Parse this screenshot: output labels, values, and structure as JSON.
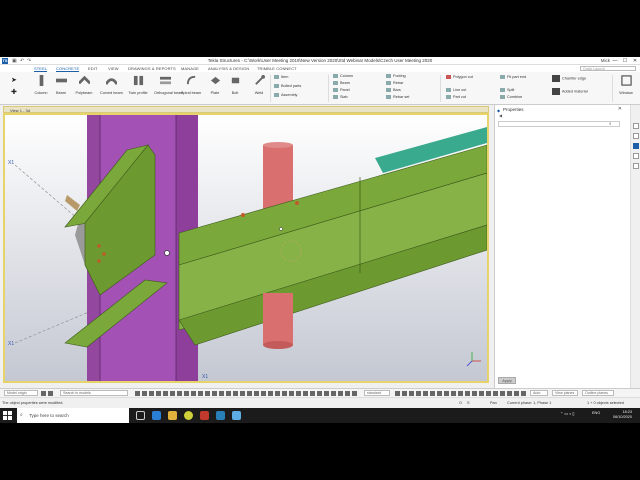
{
  "window": {
    "title": "Tekla Structures - C:\\Work\\User Meeting 2019\\New Version 2020\\Xtd Webinar Models\\Czech User Meeting 2020",
    "user": "Mick",
    "logo": "TS",
    "controls": [
      "—",
      "☐",
      "✕"
    ]
  },
  "ribbon_tabs": [
    {
      "label": "STEEL",
      "active": true
    },
    {
      "label": "CONCRETE",
      "active": true
    },
    {
      "label": "EDIT"
    },
    {
      "label": "VIEW"
    },
    {
      "label": "DRAWINGS & REPORTS"
    },
    {
      "label": "MANAGE"
    },
    {
      "label": "ANALYSIS & DESIGN"
    },
    {
      "label": "TRIMBLE CONNECT"
    }
  ],
  "quick_launch": {
    "placeholder": "Quick Launch"
  },
  "ribbon": {
    "tools": [
      {
        "label": "Column",
        "icon": "column-icon"
      },
      {
        "label": "Beam",
        "icon": "beam-icon"
      },
      {
        "label": "Polybeam",
        "icon": "polybeam-icon"
      },
      {
        "label": "Curved beam",
        "icon": "curved-beam-icon"
      },
      {
        "label": "Twin profile",
        "icon": "twin-profile-icon"
      },
      {
        "label": "Orthogonal beam",
        "icon": "orthogonal-beam-icon"
      },
      {
        "label": "Spiral beam",
        "icon": "spiral-beam-icon"
      },
      {
        "label": "Plate",
        "icon": "plate-icon"
      },
      {
        "label": "Bolt",
        "icon": "bolt-icon"
      },
      {
        "label": "Weld",
        "icon": "weld-icon"
      }
    ],
    "small_tools": {
      "item": "Item",
      "bolted_parts": "Bolted parts",
      "assembly": "Assembly",
      "column": "Column",
      "beam": "Beam",
      "panel": "Panel",
      "slab": "Slab",
      "footing": "Footing",
      "rebar": "Rebar",
      "bars": "Bars",
      "rebar_set": "Rebar set",
      "polygon_cut": "Polygon cut",
      "line_cut": "Line cut",
      "part_cut": "Part cut",
      "fit_part_end": "Fit part end",
      "split": "Split",
      "combine": "Combine",
      "chamfer_edge": "Chamfer edge",
      "added_material": "Added material",
      "window": "Window"
    }
  },
  "view": {
    "title": "View 1 - 3d",
    "axis_labels": {
      "left_top": "X1",
      "left_bottom": "X1",
      "bottom": "X1"
    }
  },
  "properties_panel": {
    "title": "Properties",
    "apply": "Apply"
  },
  "status_row": {
    "model_origin": "Model origin",
    "search_placeholder": "Search in models",
    "standard": "standard",
    "auto": "Auto",
    "view_planes": "View planes",
    "outline_planes": "Outline planes"
  },
  "bottom_status": {
    "message": "The object properties were modified.",
    "o": "O",
    "s": "S",
    "pan": "Pan",
    "phase": "Current phase: 1, Phase 1",
    "selection": "1 + 0 objects selected"
  },
  "taskbar": {
    "search_placeholder": "Type here to search",
    "lang": "ENG",
    "time": "18:23",
    "date": "06/10/2020"
  },
  "colors": {
    "steel_green": "#7aa83a",
    "column_magenta": "#a451b5",
    "pipe_red": "#d96f6f",
    "teal_part": "#3aaa8e",
    "view_border": "#e6d36a",
    "brand_blue": "#1a5fa8"
  }
}
